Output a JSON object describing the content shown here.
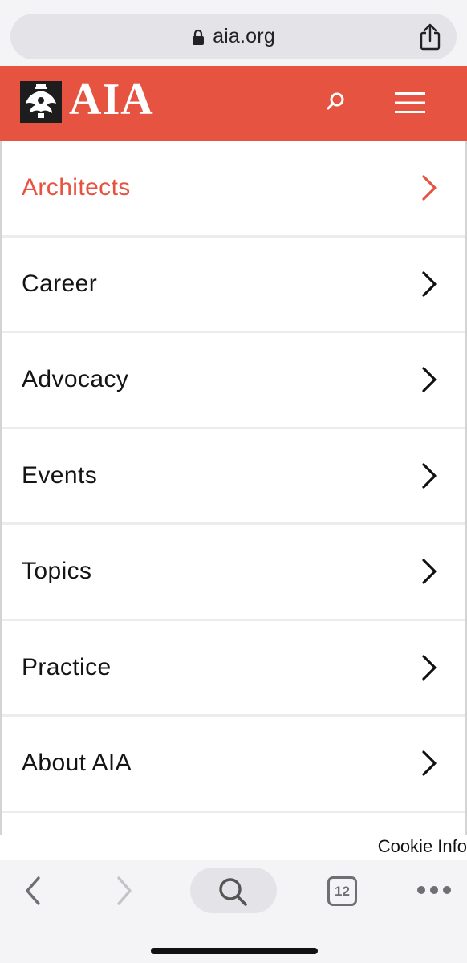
{
  "browser": {
    "url": "aia.org",
    "tab_count": "12"
  },
  "header": {
    "logo_text": "AIA",
    "brand_color": "#e65340"
  },
  "menu": {
    "items": [
      {
        "label": "Architects",
        "active": true
      },
      {
        "label": "Career",
        "active": false
      },
      {
        "label": "Advocacy",
        "active": false
      },
      {
        "label": "Events",
        "active": false
      },
      {
        "label": "Topics",
        "active": false
      },
      {
        "label": "Practice",
        "active": false
      },
      {
        "label": "About AIA",
        "active": false
      }
    ]
  },
  "cookie": {
    "label": "Cookie Info"
  },
  "toolbar": {
    "icons": [
      "back-icon",
      "forward-icon",
      "search-icon",
      "tabs-icon",
      "more-icon"
    ]
  }
}
